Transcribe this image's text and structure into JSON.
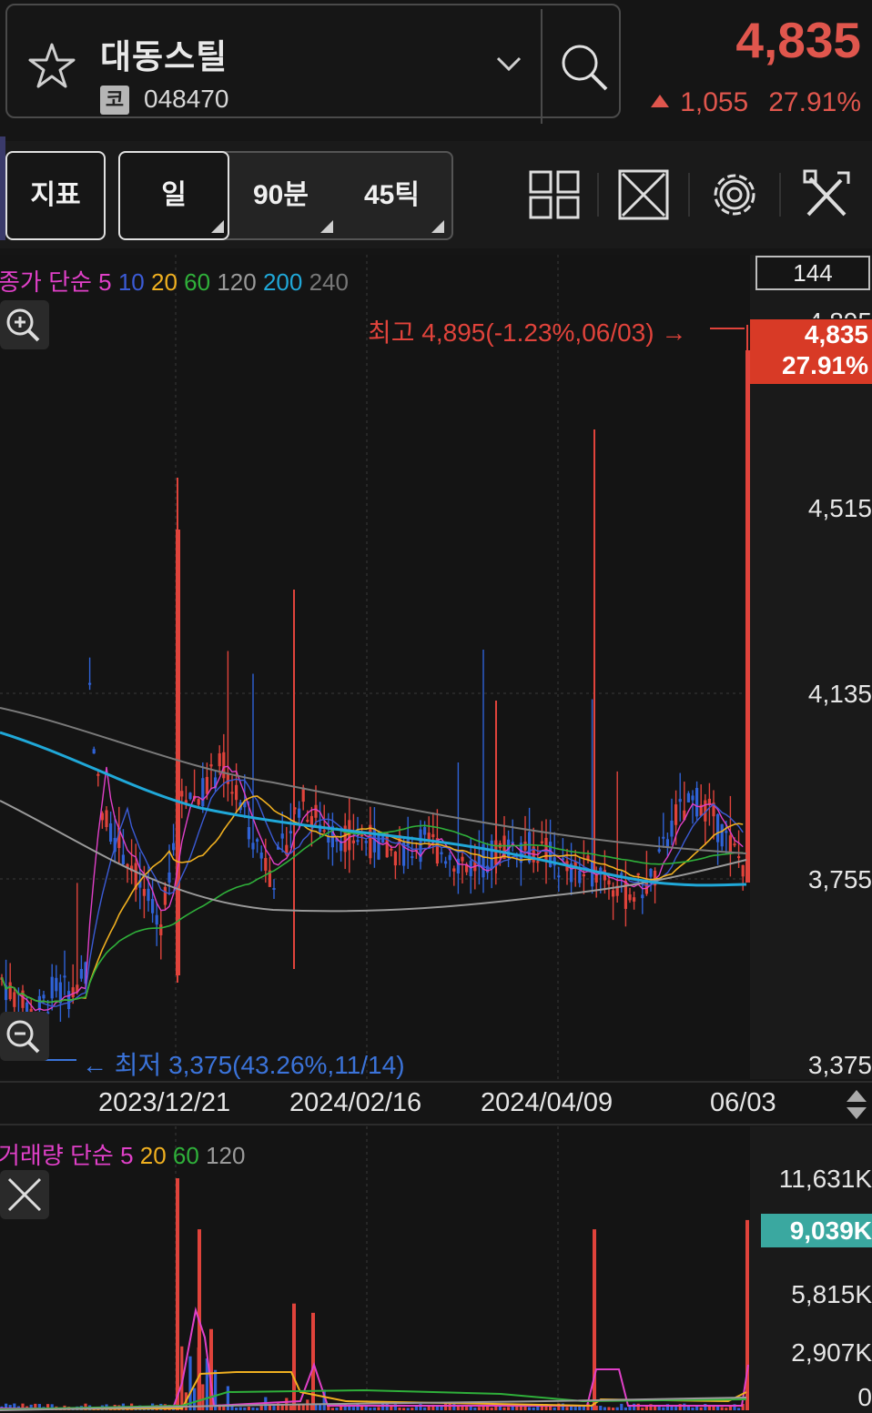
{
  "stock": {
    "name": "대동스틸",
    "market_badge": "코",
    "code": "048470",
    "price": "4,835",
    "change": "1,055",
    "change_pct": "27.91%"
  },
  "toolbar": {
    "indicator_label": "지표",
    "period_day": "일",
    "period_90": "90분",
    "period_45tick": "45틱"
  },
  "icons": [
    "star-icon",
    "chevron-down-icon",
    "search-icon",
    "layout-grid-icon",
    "fullscreen-icon",
    "gear-icon",
    "tools-icon",
    "zoom-in-icon",
    "zoom-out-icon",
    "close-icon",
    "scroll-arrows-icon"
  ],
  "chart": {
    "candle_count": "144",
    "ma_legend": {
      "title": "종가 단순",
      "p5": "5",
      "p10": "10",
      "p20": "20",
      "p60": "60",
      "p120": "120",
      "p200": "200",
      "p240": "240"
    },
    "y_labels": [
      "4,895",
      "4,515",
      "4,135",
      "3,755",
      "3,375"
    ],
    "x_labels": [
      "2023/12/21",
      "2024/02/16",
      "2024/04/09",
      "06/03"
    ],
    "current_price_tag": "4,835",
    "current_pct_tag": "27.91%",
    "max_annotation": "최고 4,895(-1.23%,06/03) →",
    "min_annotation": "← 최저 3,375(43.26%,11/14)"
  },
  "volume": {
    "legend": {
      "title": "거래량 단순",
      "p5": "5",
      "p20": "20",
      "p60": "60",
      "p120": "120"
    },
    "y_labels": [
      "11,631K",
      "5,815K",
      "2,907K",
      "0"
    ],
    "current_tag": "9,039K"
  },
  "colors": {
    "up": "#e0433b",
    "down": "#2f62d6",
    "ma5": "#e040c8",
    "ma10": "#3b5bd6",
    "ma20": "#f0b020",
    "ma60": "#2fb03a",
    "ma120": "#9a9a9a",
    "ma200": "#20a8d8",
    "ma240": "#7a7a7a"
  },
  "chart_data": {
    "type": "candlestick",
    "ylim": [
      3375,
      4895
    ],
    "x": [
      "2023/12/21",
      "2024/02/16",
      "2024/04/09",
      "06/03"
    ],
    "last_close": 4835,
    "high": 4895,
    "low": 3375
  }
}
